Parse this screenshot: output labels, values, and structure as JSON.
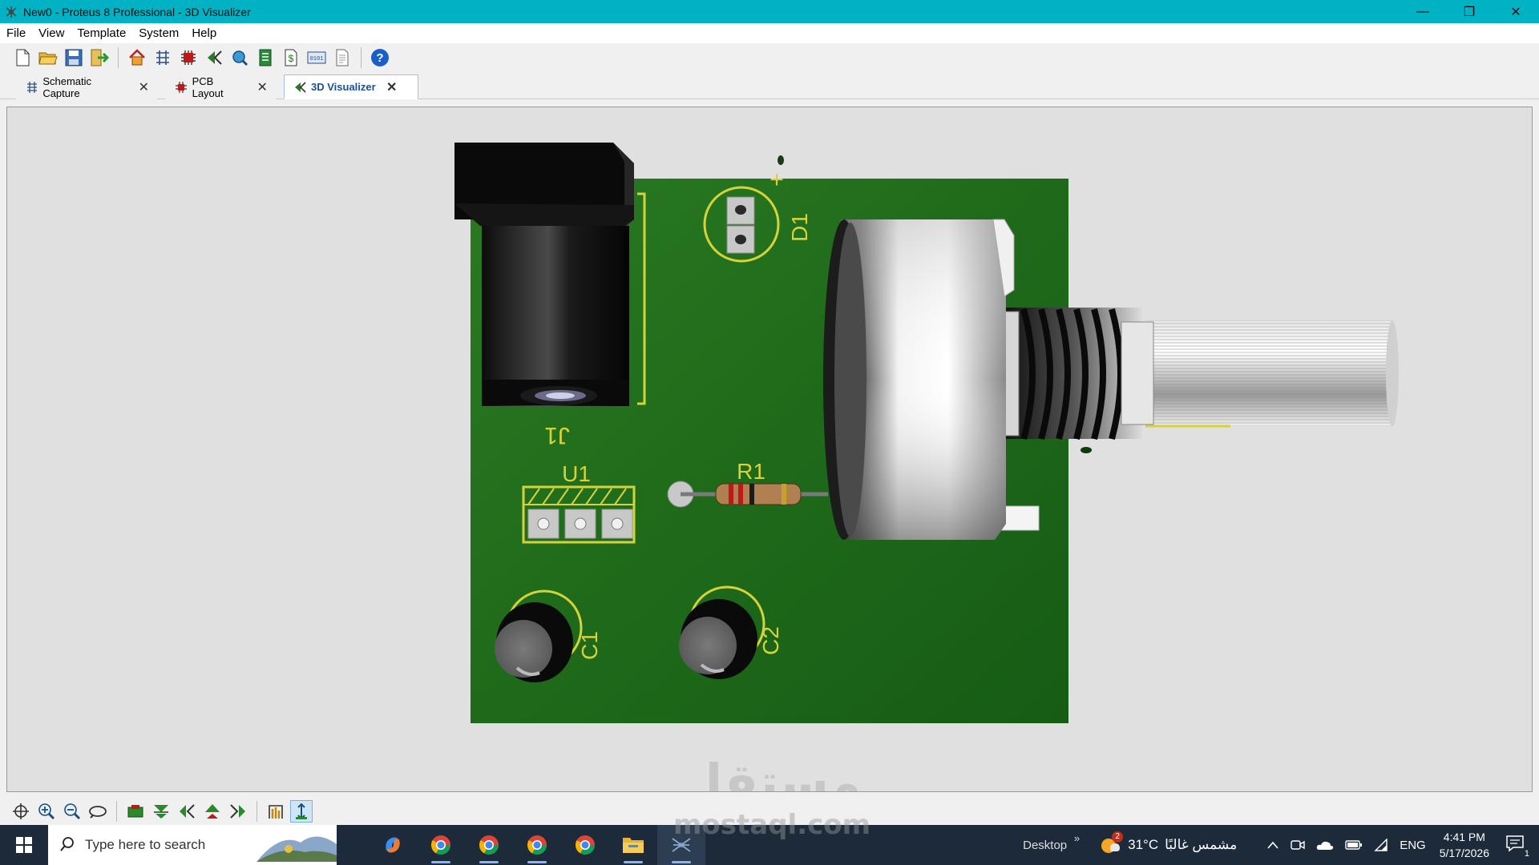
{
  "window": {
    "title": "New0 - Proteus 8 Professional - 3D Visualizer",
    "minimize": "—",
    "maximize": "❐",
    "close": "✕"
  },
  "menu": [
    "File",
    "View",
    "Template",
    "System",
    "Help"
  ],
  "toolbar_icons": [
    "new-file-icon",
    "open-folder-icon",
    "save-icon",
    "import-icon",
    "home-icon",
    "schematic-icon",
    "pcb-icon",
    "3d-visualizer-icon",
    "gerber-viewer-icon",
    "bom-icon",
    "design-explorer-icon",
    "vsm-studio-icon",
    "notes-icon",
    "help-icon"
  ],
  "tabs": [
    {
      "label": "Schematic Capture",
      "icon": "schematic-icon",
      "active": false
    },
    {
      "label": "PCB Layout",
      "icon": "pcb-chip-icon",
      "active": false
    },
    {
      "label": "3D Visualizer",
      "icon": "3d-visualizer-icon",
      "active": true
    }
  ],
  "board": {
    "color": "#1c6b1c",
    "silk_color": "#d8d23a",
    "labels": {
      "j1": "J1",
      "d1": "D1",
      "plus": "+",
      "u1": "U1",
      "r1": "R1",
      "c1": "C1",
      "c2": "C2"
    }
  },
  "bottom_toolbar_icons": [
    "pan-icon",
    "zoom-in-icon",
    "zoom-out-icon",
    "orbit-icon",
    "top-view-icon",
    "front-view-icon",
    "left-view-icon",
    "back-view-icon",
    "right-view-icon",
    "height-gauge-icon",
    "component-height-icon"
  ],
  "taskbar": {
    "search_placeholder": "Type here to search",
    "apps": [
      "copilot-icon",
      "chrome-icon",
      "chrome-icon",
      "chrome-icon",
      "chrome-icon",
      "file-explorer-icon",
      "proteus-icon"
    ],
    "desktop_label": "Desktop",
    "desktop_chevron": "»",
    "weather_badge": "2",
    "weather_temp": "31°C",
    "weather_desc": "مشمس غالبًا",
    "language": "ENG",
    "time": "4:41 PM",
    "date": "5/17/2026",
    "notification_count": "1"
  },
  "watermark": {
    "arabic": "مستقل",
    "latin": "mostaql.com"
  }
}
